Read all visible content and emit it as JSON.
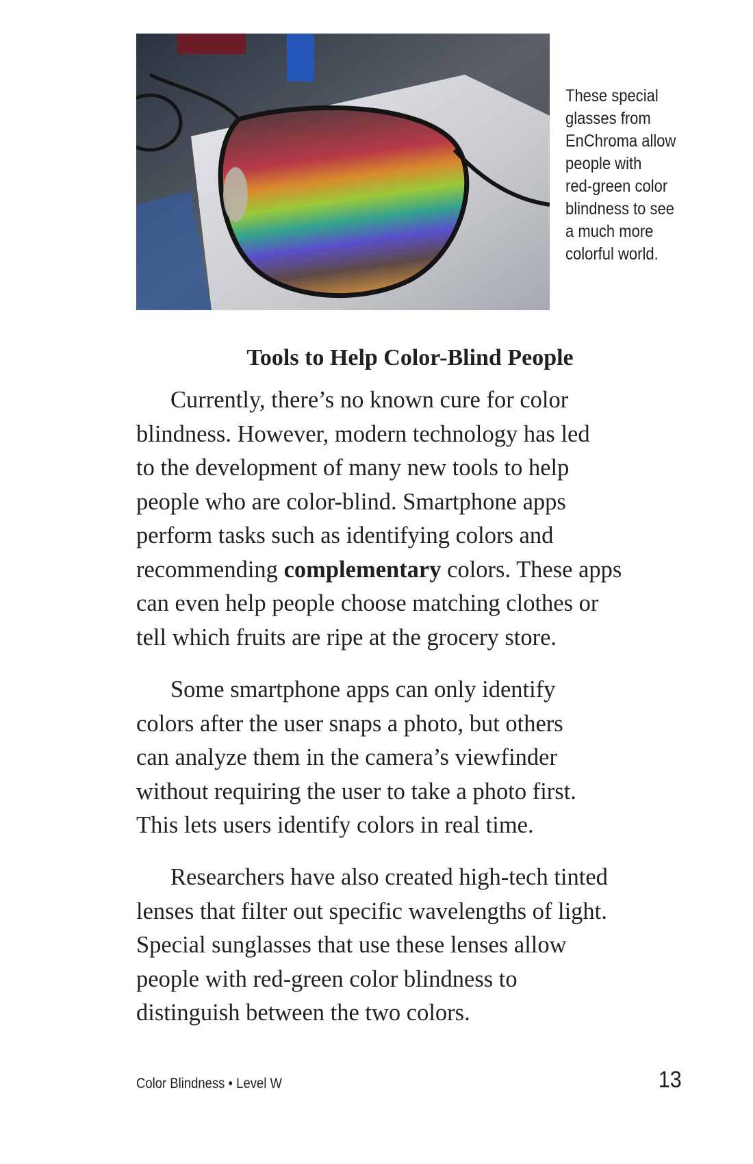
{
  "figure": {
    "caption_lines": [
      "These special",
      "glasses from",
      "EnChroma allow",
      "people with",
      "red-green color",
      "blindness to see",
      "a much more",
      "colorful world."
    ]
  },
  "section": {
    "heading": "Tools to Help Color-Blind People",
    "paragraphs": [
      {
        "lines": [
          "Currently, there’s no known cure for color",
          "blindness. However, modern technology has led",
          "to the development of many new tools to help",
          "people who are color-blind. Smartphone apps",
          "perform tasks such as identifying colors and"
        ],
        "line6": {
          "before": "recommending ",
          "bold": "complementary",
          "after": " colors. These apps"
        },
        "lines_after": [
          "can even help people choose matching clothes or",
          "tell which fruits are ripe at the grocery store."
        ]
      },
      {
        "lines": [
          "Some smartphone apps can only identify",
          "colors after the user snaps a photo, but others",
          "can analyze them in the camera’s viewfinder",
          "without requiring the user to take a photo first.",
          "This lets users identify colors in real time."
        ]
      },
      {
        "lines": [
          "Researchers have also created high-tech tinted",
          "lenses that filter out specific wavelengths of light.",
          "Special sunglasses that use these lenses allow",
          "people with red-green color blindness to",
          "distinguish between the two colors."
        ]
      }
    ]
  },
  "footer": {
    "book_label": "Color Blindness • Level W",
    "page_number": "13"
  }
}
